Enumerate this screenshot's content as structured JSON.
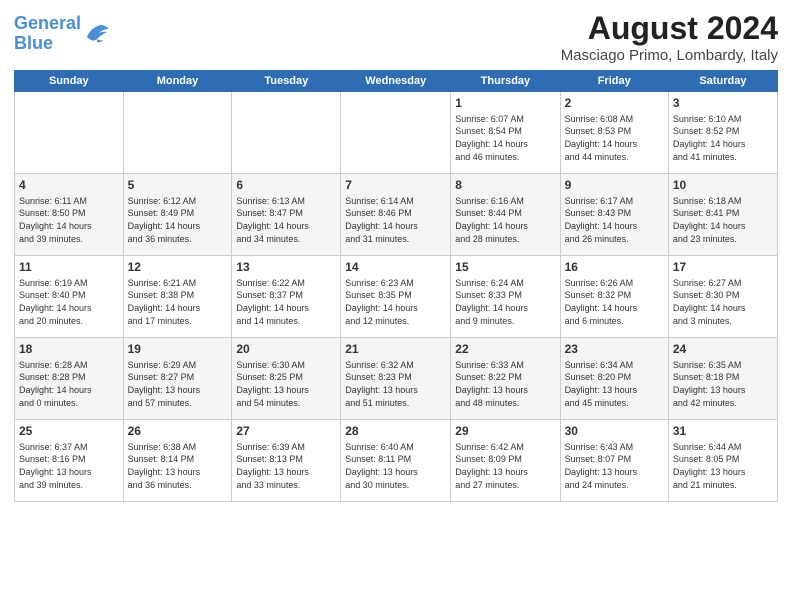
{
  "header": {
    "logo_line1": "General",
    "logo_line2": "Blue",
    "title": "August 2024",
    "subtitle": "Masciago Primo, Lombardy, Italy"
  },
  "days_of_week": [
    "Sunday",
    "Monday",
    "Tuesday",
    "Wednesday",
    "Thursday",
    "Friday",
    "Saturday"
  ],
  "weeks": [
    [
      {
        "day": "",
        "content": ""
      },
      {
        "day": "",
        "content": ""
      },
      {
        "day": "",
        "content": ""
      },
      {
        "day": "",
        "content": ""
      },
      {
        "day": "1",
        "content": "Sunrise: 6:07 AM\nSunset: 8:54 PM\nDaylight: 14 hours\nand 46 minutes."
      },
      {
        "day": "2",
        "content": "Sunrise: 6:08 AM\nSunset: 8:53 PM\nDaylight: 14 hours\nand 44 minutes."
      },
      {
        "day": "3",
        "content": "Sunrise: 6:10 AM\nSunset: 8:52 PM\nDaylight: 14 hours\nand 41 minutes."
      }
    ],
    [
      {
        "day": "4",
        "content": "Sunrise: 6:11 AM\nSunset: 8:50 PM\nDaylight: 14 hours\nand 39 minutes."
      },
      {
        "day": "5",
        "content": "Sunrise: 6:12 AM\nSunset: 8:49 PM\nDaylight: 14 hours\nand 36 minutes."
      },
      {
        "day": "6",
        "content": "Sunrise: 6:13 AM\nSunset: 8:47 PM\nDaylight: 14 hours\nand 34 minutes."
      },
      {
        "day": "7",
        "content": "Sunrise: 6:14 AM\nSunset: 8:46 PM\nDaylight: 14 hours\nand 31 minutes."
      },
      {
        "day": "8",
        "content": "Sunrise: 6:16 AM\nSunset: 8:44 PM\nDaylight: 14 hours\nand 28 minutes."
      },
      {
        "day": "9",
        "content": "Sunrise: 6:17 AM\nSunset: 8:43 PM\nDaylight: 14 hours\nand 26 minutes."
      },
      {
        "day": "10",
        "content": "Sunrise: 6:18 AM\nSunset: 8:41 PM\nDaylight: 14 hours\nand 23 minutes."
      }
    ],
    [
      {
        "day": "11",
        "content": "Sunrise: 6:19 AM\nSunset: 8:40 PM\nDaylight: 14 hours\nand 20 minutes."
      },
      {
        "day": "12",
        "content": "Sunrise: 6:21 AM\nSunset: 8:38 PM\nDaylight: 14 hours\nand 17 minutes."
      },
      {
        "day": "13",
        "content": "Sunrise: 6:22 AM\nSunset: 8:37 PM\nDaylight: 14 hours\nand 14 minutes."
      },
      {
        "day": "14",
        "content": "Sunrise: 6:23 AM\nSunset: 8:35 PM\nDaylight: 14 hours\nand 12 minutes."
      },
      {
        "day": "15",
        "content": "Sunrise: 6:24 AM\nSunset: 8:33 PM\nDaylight: 14 hours\nand 9 minutes."
      },
      {
        "day": "16",
        "content": "Sunrise: 6:26 AM\nSunset: 8:32 PM\nDaylight: 14 hours\nand 6 minutes."
      },
      {
        "day": "17",
        "content": "Sunrise: 6:27 AM\nSunset: 8:30 PM\nDaylight: 14 hours\nand 3 minutes."
      }
    ],
    [
      {
        "day": "18",
        "content": "Sunrise: 6:28 AM\nSunset: 8:28 PM\nDaylight: 14 hours\nand 0 minutes."
      },
      {
        "day": "19",
        "content": "Sunrise: 6:29 AM\nSunset: 8:27 PM\nDaylight: 13 hours\nand 57 minutes."
      },
      {
        "day": "20",
        "content": "Sunrise: 6:30 AM\nSunset: 8:25 PM\nDaylight: 13 hours\nand 54 minutes."
      },
      {
        "day": "21",
        "content": "Sunrise: 6:32 AM\nSunset: 8:23 PM\nDaylight: 13 hours\nand 51 minutes."
      },
      {
        "day": "22",
        "content": "Sunrise: 6:33 AM\nSunset: 8:22 PM\nDaylight: 13 hours\nand 48 minutes."
      },
      {
        "day": "23",
        "content": "Sunrise: 6:34 AM\nSunset: 8:20 PM\nDaylight: 13 hours\nand 45 minutes."
      },
      {
        "day": "24",
        "content": "Sunrise: 6:35 AM\nSunset: 8:18 PM\nDaylight: 13 hours\nand 42 minutes."
      }
    ],
    [
      {
        "day": "25",
        "content": "Sunrise: 6:37 AM\nSunset: 8:16 PM\nDaylight: 13 hours\nand 39 minutes."
      },
      {
        "day": "26",
        "content": "Sunrise: 6:38 AM\nSunset: 8:14 PM\nDaylight: 13 hours\nand 36 minutes."
      },
      {
        "day": "27",
        "content": "Sunrise: 6:39 AM\nSunset: 8:13 PM\nDaylight: 13 hours\nand 33 minutes."
      },
      {
        "day": "28",
        "content": "Sunrise: 6:40 AM\nSunset: 8:11 PM\nDaylight: 13 hours\nand 30 minutes."
      },
      {
        "day": "29",
        "content": "Sunrise: 6:42 AM\nSunset: 8:09 PM\nDaylight: 13 hours\nand 27 minutes."
      },
      {
        "day": "30",
        "content": "Sunrise: 6:43 AM\nSunset: 8:07 PM\nDaylight: 13 hours\nand 24 minutes."
      },
      {
        "day": "31",
        "content": "Sunrise: 6:44 AM\nSunset: 8:05 PM\nDaylight: 13 hours\nand 21 minutes."
      }
    ]
  ]
}
